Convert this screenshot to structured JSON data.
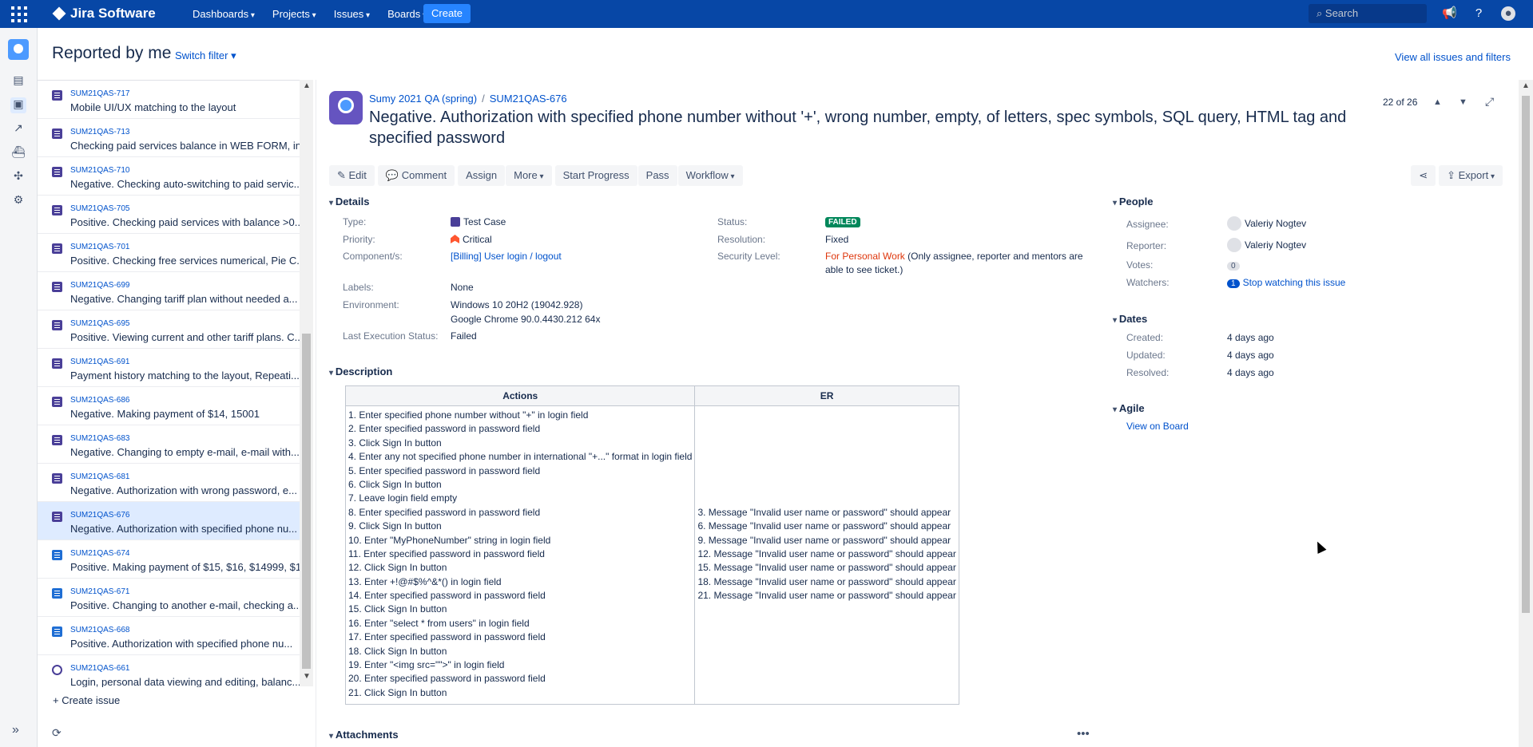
{
  "topnav": {
    "app_name": "Jira Software",
    "items": [
      "Dashboards",
      "Projects",
      "Issues",
      "Boards"
    ],
    "create_label": "Create",
    "search_placeholder": "Search"
  },
  "header": {
    "title": "Reported by me",
    "switch_filter": "Switch filter",
    "view_all": "View all issues and filters"
  },
  "issue_list": [
    {
      "key": "SUM21QAS-717",
      "summary": "Mobile UI/UX matching to the layout",
      "icon": "test-case-icon"
    },
    {
      "key": "SUM21QAS-713",
      "summary": "Checking paid services balance in WEB FORM, in ...",
      "icon": "test-case-icon"
    },
    {
      "key": "SUM21QAS-710",
      "summary": "Negative. Checking auto-switching to paid servic...",
      "icon": "test-case-icon"
    },
    {
      "key": "SUM21QAS-705",
      "summary": "Positive. Checking paid services with balance >0....",
      "icon": "test-case-icon"
    },
    {
      "key": "SUM21QAS-701",
      "summary": "Positive. Checking free services numerical, Pie C...",
      "icon": "test-case-icon"
    },
    {
      "key": "SUM21QAS-699",
      "summary": "Negative. Changing tariff plan without needed a...",
      "icon": "test-case-icon"
    },
    {
      "key": "SUM21QAS-695",
      "summary": "Positive. Viewing current and other tariff plans. C...",
      "icon": "test-case-icon"
    },
    {
      "key": "SUM21QAS-691",
      "summary": "Payment history matching to the layout, Repeati...",
      "icon": "test-case-icon"
    },
    {
      "key": "SUM21QAS-686",
      "summary": "Negative. Making payment of $14, 15001",
      "icon": "test-case-icon"
    },
    {
      "key": "SUM21QAS-683",
      "summary": "Negative. Changing to empty e-mail, e-mail with...",
      "icon": "test-case-icon"
    },
    {
      "key": "SUM21QAS-681",
      "summary": "Negative. Authorization with wrong password, e...",
      "icon": "test-case-icon"
    },
    {
      "key": "SUM21QAS-676",
      "summary": "Negative. Authorization with specified phone nu...",
      "icon": "test-case-icon"
    },
    {
      "key": "SUM21QAS-674",
      "summary": "Positive. Making payment of $15, $16, $14999, $1...",
      "icon": "test-execution-icon"
    },
    {
      "key": "SUM21QAS-671",
      "summary": "Positive. Changing to another e-mail, checking a...",
      "icon": "test-execution-icon"
    },
    {
      "key": "SUM21QAS-668",
      "summary": "Positive. Authorization with specified phone nu...",
      "icon": "test-execution-icon"
    },
    {
      "key": "SUM21QAS-661",
      "summary": "Login, personal data viewing and editing, balanc...",
      "icon": "test-plan-icon"
    }
  ],
  "selected_key": "SUM21QAS-676",
  "create_issue": "Create issue",
  "issue": {
    "project": "Sumy 2021 QA (spring)",
    "key": "SUM21QAS-676",
    "title": "Negative. Authorization with specified phone number without '+', wrong number, empty, of letters, spec symbols, SQL query, HTML tag and specified password",
    "counter": "22 of 26",
    "toolbar": {
      "edit": "Edit",
      "comment": "Comment",
      "assign": "Assign",
      "more": "More",
      "start_progress": "Start Progress",
      "pass": "Pass",
      "workflow": "Workflow",
      "export": "Export"
    },
    "details_header": "Details",
    "details": {
      "type_label": "Type:",
      "type": "Test Case",
      "priority_label": "Priority:",
      "priority": "Critical",
      "components_label": "Component/s:",
      "components": "[Billing] User login / logout",
      "labels_label": "Labels:",
      "labels": "None",
      "environment_label": "Environment:",
      "environment_1": "Windows 10 20H2 (19042.928)",
      "environment_2": "Google Chrome 90.0.4430.212 64x",
      "last_exec_label": "Last Execution Status:",
      "last_exec": "Failed",
      "status_label": "Status:",
      "status": "FAILED",
      "resolution_label": "Resolution:",
      "resolution": "Fixed",
      "security_label": "Security Level:",
      "security": "For Personal Work",
      "security_note_1": "(Only assignee, reporter and mentors are",
      "security_note_2": "able to see ticket.)"
    },
    "description_header": "Description",
    "table": {
      "headers": [
        "Actions",
        "ER"
      ],
      "actions": [
        "1. Enter specified phone number without \"+\" in login field",
        "2. Enter specified password in password field",
        "3. Click Sign In button",
        "4. Enter any not specified phone number in international \"+...\" format in login field",
        "5. Enter specified password in password field",
        "6. Click Sign In button",
        "7. Leave login field empty",
        "8. Enter specified password in password field",
        "9. Click Sign In button",
        "10. Enter \"MyPhoneNumber\" string in login field",
        "11. Enter specified password in password field",
        "12. Click Sign In button",
        "13. Enter +!@#$%^&*() in login field",
        "14. Enter specified password in password field",
        "15. Click Sign In button",
        "16. Enter \"select * from users\" in login field",
        "17. Enter specified password in password field",
        "18. Click Sign In button",
        "19. Enter \"<img src=\"\">\"  in login field",
        "20. Enter specified password in password field",
        "21. Click Sign In button"
      ],
      "er": [
        "3. Message \"Invalid user name or password\" should appear",
        "6. Message \"Invalid user name or password\" should appear",
        "9. Message \"Invalid user name or password\" should appear",
        "12. Message \"Invalid user name or password\" should appear",
        "15. Message \"Invalid user name or password\" should appear",
        "18. Message \"Invalid user name or password\" should appear",
        "21. Message \"Invalid user name or password\" should appear"
      ]
    },
    "attachments_header": "Attachments",
    "people_header": "People",
    "people": {
      "assignee_label": "Assignee:",
      "assignee": "Valeriy Nogtev",
      "reporter_label": "Reporter:",
      "reporter": "Valeriy Nogtev",
      "votes_label": "Votes:",
      "votes": "0",
      "watchers_label": "Watchers:",
      "watchers_count": "1",
      "watchers_link": "Stop watching this issue"
    },
    "dates_header": "Dates",
    "dates": {
      "created_label": "Created:",
      "created": "4 days ago",
      "updated_label": "Updated:",
      "updated": "4 days ago",
      "resolved_label": "Resolved:",
      "resolved": "4 days ago"
    },
    "agile_header": "Agile",
    "agile_link": "View on Board"
  }
}
